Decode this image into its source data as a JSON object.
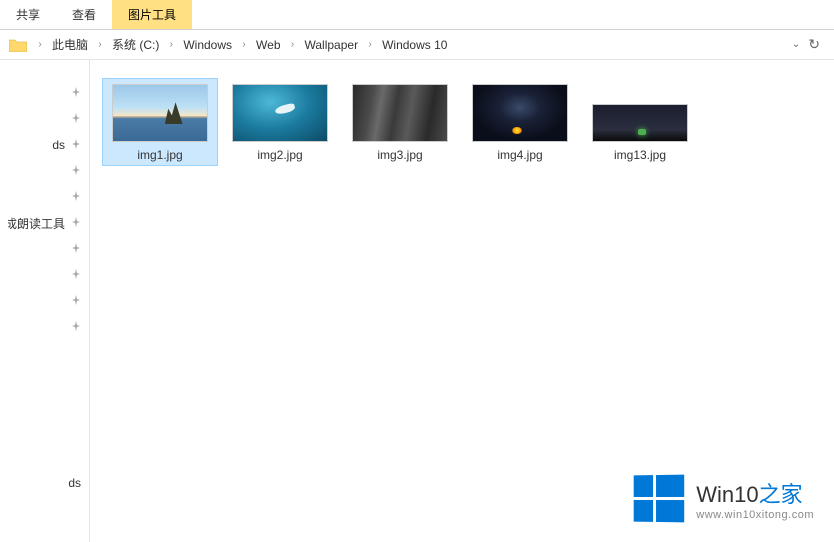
{
  "ribbon": {
    "tabs": [
      "共享",
      "查看"
    ],
    "contextual_tab": "图片工具"
  },
  "breadcrumb": {
    "items": [
      "此电脑",
      "系统 (C:)",
      "Windows",
      "Web",
      "Wallpaper",
      "Windows 10"
    ]
  },
  "sidebar": {
    "items": [
      {
        "label": ""
      },
      {
        "label": ""
      },
      {
        "label": "ds"
      },
      {
        "label": ""
      },
      {
        "label": ""
      },
      {
        "label": "合成朗读工具\\"
      },
      {
        "label": ""
      },
      {
        "label": ""
      },
      {
        "label": ""
      },
      {
        "label": ""
      }
    ],
    "bottom_label": "ds"
  },
  "files": [
    {
      "name": "img1.jpg",
      "art": "beach",
      "selected": true,
      "short": false
    },
    {
      "name": "img2.jpg",
      "art": "ocean",
      "selected": false,
      "short": false
    },
    {
      "name": "img3.jpg",
      "art": "rock",
      "selected": false,
      "short": false
    },
    {
      "name": "img4.jpg",
      "art": "milky",
      "selected": false,
      "short": false
    },
    {
      "name": "img13.jpg",
      "art": "night",
      "selected": false,
      "short": true
    }
  ],
  "watermark": {
    "title_main": "Win10",
    "title_accent": "之家",
    "url": "www.win10xitong.com"
  }
}
